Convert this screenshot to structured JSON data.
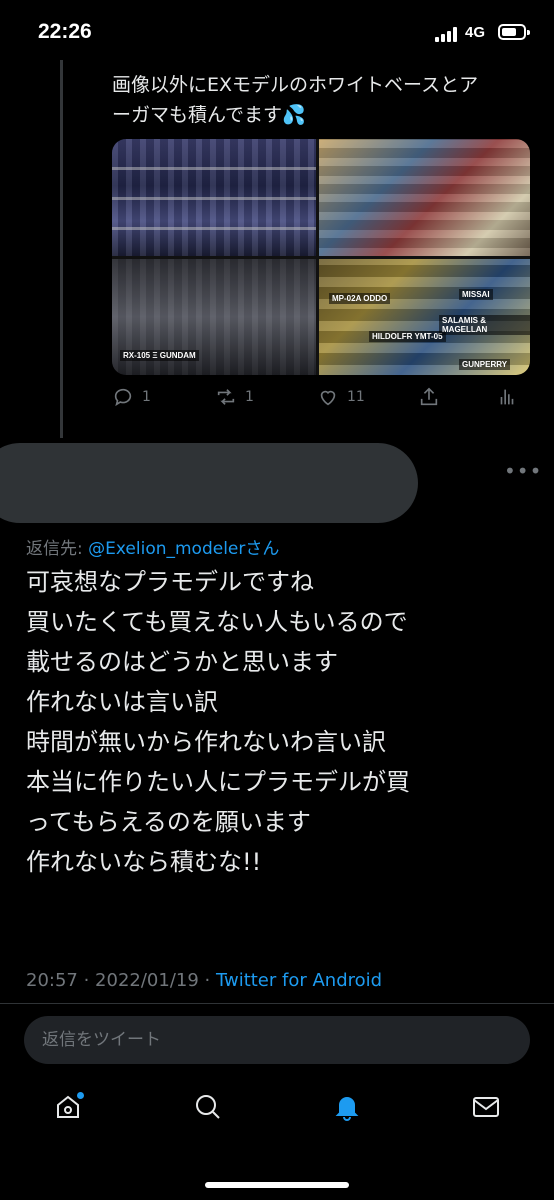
{
  "status_bar": {
    "time": "22:26",
    "network": "4G"
  },
  "quoted_tweet": {
    "text_line1": "画像以外にEXモデルのホワイトベースとア",
    "text_line2": "ーガマも積んでます",
    "emoji": "💦",
    "media_labels": [
      "RX-105 Ξ GUNDAM",
      "MP-02A ODDO",
      "HILDOLFR YMT-05",
      "GUNPERRY",
      "MISSAI",
      "SALAMIS & MAGELLAN"
    ],
    "actions": {
      "reply_count": "1",
      "retweet_count": "1",
      "like_count": "11"
    }
  },
  "reply": {
    "reply_to_prefix": "返信先: ",
    "reply_to_handle": "@Exelion_modelerさん",
    "lines": [
      "可哀想なプラモデルですね",
      "買いたくても買えない人もいるので",
      "載せるのはどうかと思います",
      "作れないは言い訳",
      "時間が無いから作れないわ言い訳",
      "本当に作りたい人にプラモデルが買",
      "ってもらえるのを願います",
      "作れないなら積むな!!"
    ],
    "timestamp": "20:57 · 2022/01/19 · ",
    "source": "Twitter for Android"
  },
  "reply_box": {
    "placeholder": "返信をツイート"
  },
  "colors": {
    "accent": "#1d9bf0",
    "muted": "#71767b",
    "background": "#000000"
  },
  "tabbar": {
    "items": [
      "home-icon",
      "search-icon",
      "notifications-icon",
      "messages-icon"
    ],
    "active": "notifications-icon"
  }
}
